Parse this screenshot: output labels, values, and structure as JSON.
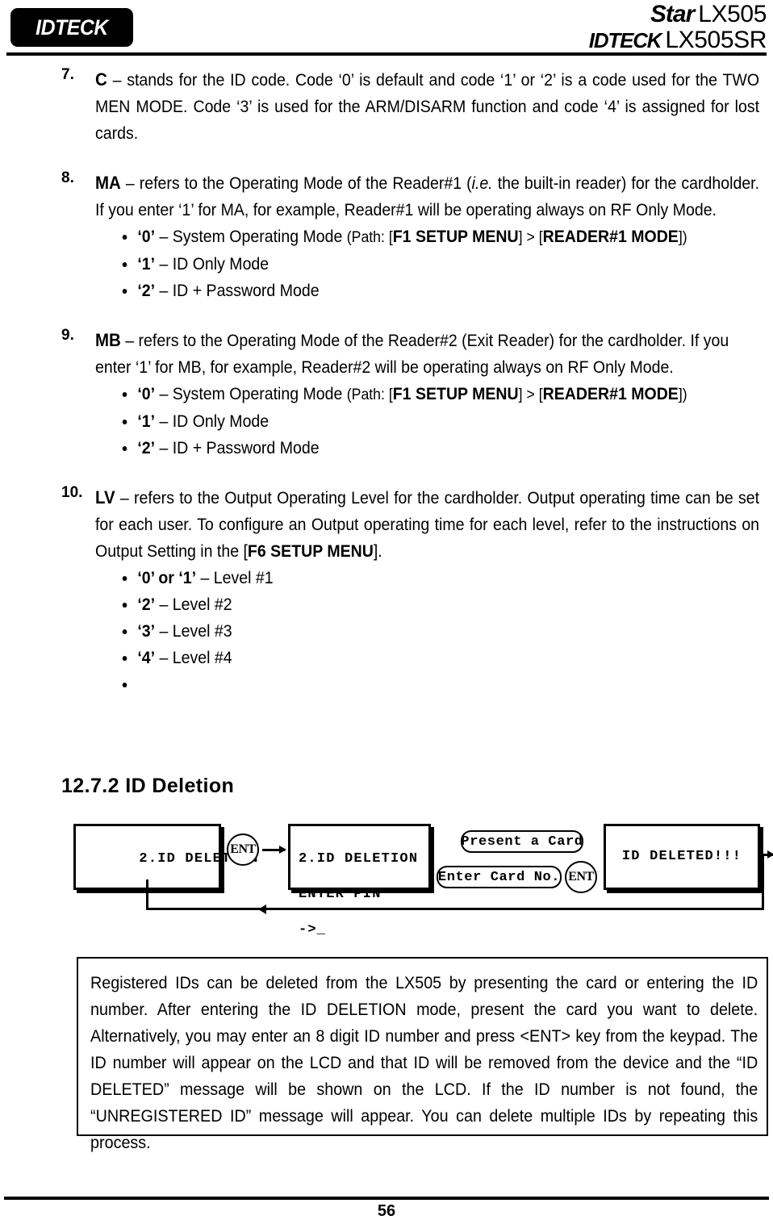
{
  "header": {
    "logo_text": "IDTECK",
    "brand_star": "Star",
    "brand_model_1": "LX505",
    "brand_idteck": "IDTECK",
    "brand_model_2": "LX505SR"
  },
  "items": [
    {
      "number": "7.",
      "key": "C",
      "text_before": " – stands for the ID code. Code ‘0’ is default and code ‘1’ or ‘2’ is a code used for the TWO MEN MODE. Code ‘3’ is used for the ARM/DISARM function and code ‘4’ is assigned for lost cards."
    },
    {
      "number": "8.",
      "key": "MA",
      "text_before": " – refers to the Operating Mode of the Reader#1 (",
      "italic": "i.e.",
      "text_after": " the built-in reader) for the cardholder. If you enter ‘1’ for MA, for example, Reader#1 will be operating always on RF Only Mode."
    },
    {
      "number": "9.",
      "key": "MB",
      "text_before": " – refers to the Operating Mode of the Reader#2 (Exit Reader) for the cardholder. If you enter ‘1’ for MB, for example, Reader#2 will be operating always on RF Only Mode."
    },
    {
      "number": "10.",
      "key": "LV",
      "text_before": " – refers to the Output Operating Level for the cardholder. Output operating time can be set for each user. To configure an Output operating time for each level, refer to the instructions on Output Setting in the [",
      "bold_mid": "F6 SETUP MENU",
      "text_after": "]."
    }
  ],
  "mode_bullets": {
    "b0_key": "‘0’",
    "b0_text": " – System Operating Mode ",
    "b0_path_prefix": "(Path: [",
    "b0_path_menu": "F1 SETUP MENU",
    "b0_path_mid": "] > [",
    "b0_path_mode": "READER#1 MODE",
    "b0_path_suffix": "])",
    "b1_key": "‘1’",
    "b1_text": " – ID Only Mode",
    "b2_key": "‘2’",
    "b2_text": " – ID + Password Mode"
  },
  "level_bullets": [
    {
      "key": "‘0’ or ‘1’",
      "text": " – Level #1"
    },
    {
      "key": "‘2’",
      "text": " – Level #2"
    },
    {
      "key": "‘3’",
      "text": " – Level #3"
    },
    {
      "key": "‘4’",
      "text": " – Level #4"
    },
    {
      "key": "",
      "text": ""
    }
  ],
  "section": {
    "heading": "12.7.2 ID Deletion"
  },
  "diagram": {
    "lcd1_line1": "2.ID DELETION",
    "ent1_label": "ENT",
    "lcd2_line1": "2.ID DELETION",
    "lcd2_line2": "ENTER PIN",
    "lcd2_line3": "->_",
    "pill_present": "Present a Card",
    "pill_enter": "Enter Card No.",
    "ent2_label": "ENT",
    "lcd3_line1": "ID DELETED!!!"
  },
  "note": {
    "text": "Registered IDs can be deleted from the LX505 by presenting the card or entering the ID number. After entering the ID DELETION mode, present the card you want to delete. Alternatively, you may enter  an 8 digit ID number and press <ENT> key from the keypad. The ID number will appear on the LCD and that ID will be removed from the device and the “ID DELETED” message will be shown on the LCD. If the ID number is not found, the “UNREGISTERED ID” message will appear. You can delete multiple IDs by repeating this process."
  },
  "footer": {
    "page_number": "56"
  }
}
